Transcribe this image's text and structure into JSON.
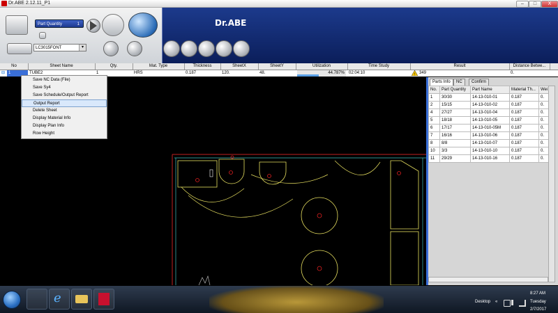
{
  "window": {
    "title": "Dr.ABE 2.12.11_P1",
    "brand": "Dr.ABE",
    "minimize": "–",
    "maximize": "□",
    "close": "X"
  },
  "toolbar": {
    "part_quantity_label": "Part Quantity",
    "part_quantity_value": "1",
    "font_select": "LC3015FONT",
    "dropdown_arrow": "▾"
  },
  "grid": {
    "headers": [
      "No",
      "Sheet Name",
      "Qty.",
      "Mat. Type",
      "Thickness",
      "SheetX",
      "SheetY",
      "Utilization",
      "Time Study",
      "Result",
      "Distance Betwe..."
    ],
    "row": {
      "no": "1",
      "sheet_name": "TUBE2",
      "qty": "1",
      "mat_type": "HRS",
      "thickness": "0.187",
      "sheetx": "120.",
      "sheety": "48.",
      "utilization": "44.787%",
      "utilization_fraction": 0.44787,
      "time_study": "02:04:10",
      "result": "349",
      "distance": "0."
    }
  },
  "context_menu": {
    "items": [
      "Save NC Data (File)",
      "Save Sy4",
      "Save Schedule/Output Report",
      "Output Report",
      "Delete Sheet",
      "Display Material Info",
      "Display Plan Info",
      "Row Height"
    ],
    "highlighted_index": 3
  },
  "right_panel": {
    "tabs": [
      "Parts Info",
      "NC",
      "Confirm"
    ],
    "active_tab": 0,
    "columns": [
      "No.",
      "Part Quantity",
      "Part Name",
      "Material Th...",
      "Wei"
    ],
    "rows": [
      [
        "1",
        "30/30",
        "14-13-010-01",
        "0.187",
        "0."
      ],
      [
        "2",
        "15/15",
        "14-13-010-02",
        "0.187",
        "0."
      ],
      [
        "4",
        "27/27",
        "14-13-010-04",
        "0.187",
        "0."
      ],
      [
        "5",
        "18/18",
        "14-13-010-05",
        "0.187",
        "0."
      ],
      [
        "6",
        "17/17",
        "14-13-010-05M",
        "0.187",
        "0."
      ],
      [
        "7",
        "16/16",
        "14-13-010-06",
        "0.187",
        "0."
      ],
      [
        "8",
        "8/8",
        "14-13-010-07",
        "0.187",
        "0."
      ],
      [
        "10",
        "3/3",
        "14-13-010-10",
        "0.187",
        "0."
      ],
      [
        "11",
        "29/29",
        "14-13-010-16",
        "0.187",
        "0."
      ]
    ]
  },
  "taskbar": {
    "desktop_label": "Desktop",
    "time": "8:27 AM",
    "day": "Tuesday",
    "date": "2/7/2017",
    "tray_chevron": "«"
  },
  "colors": {
    "accent_blue": "#1c3a8c",
    "panel_border": "#3a6fd8",
    "menu_highlight": "#d9e8fb",
    "warning": "#f2c200",
    "sheet_line": "#c02020",
    "part_yellow": "#e8e060",
    "part_cyan": "#40c0c0"
  }
}
